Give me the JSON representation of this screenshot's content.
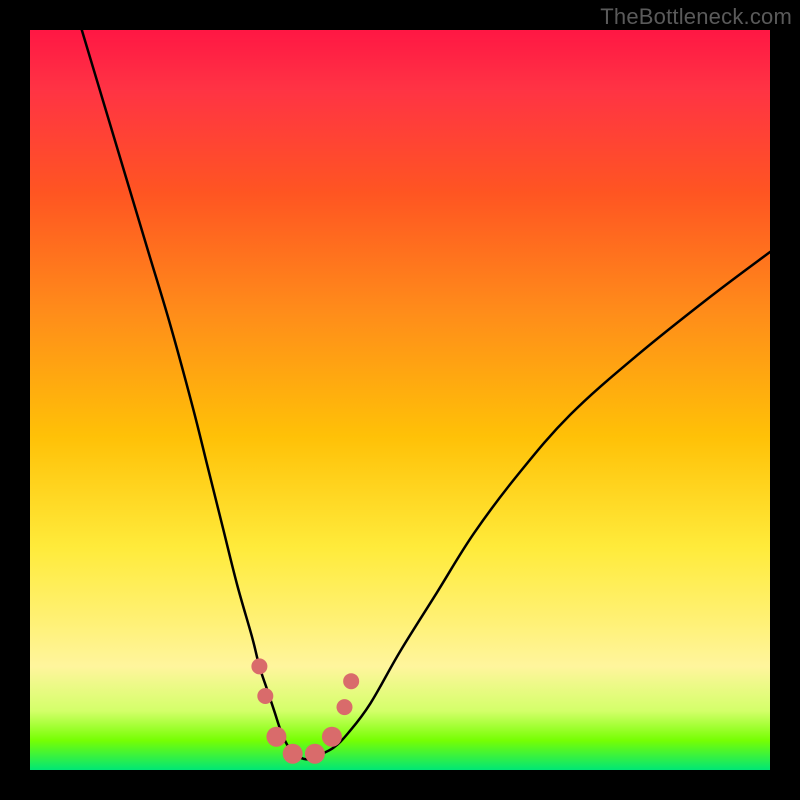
{
  "watermark": "TheBottleneck.com",
  "chart_data": {
    "type": "line",
    "title": "",
    "xlabel": "",
    "ylabel": "",
    "xlim": [
      0,
      100
    ],
    "ylim": [
      0,
      100
    ],
    "series": [
      {
        "name": "bottleneck-curve",
        "x": [
          7,
          10,
          13,
          16,
          19,
          22,
          24,
          26,
          28,
          30,
          31,
          32,
          33,
          34,
          35,
          36,
          37,
          38,
          39,
          41,
          43,
          46,
          50,
          55,
          60,
          66,
          73,
          82,
          92,
          100
        ],
        "y": [
          100,
          90,
          80,
          70,
          60,
          49,
          41,
          33,
          25,
          18,
          14,
          11,
          8,
          5,
          3,
          2,
          1.5,
          1.5,
          2,
          3,
          5,
          9,
          16,
          24,
          32,
          40,
          48,
          56,
          64,
          70
        ]
      }
    ],
    "markers": {
      "name": "highlighted-points",
      "color": "#d96b6b",
      "points": [
        {
          "x": 31.0,
          "y": 14,
          "r": 8
        },
        {
          "x": 31.8,
          "y": 10,
          "r": 8
        },
        {
          "x": 33.3,
          "y": 4.5,
          "r": 10
        },
        {
          "x": 35.5,
          "y": 2.2,
          "r": 10
        },
        {
          "x": 38.5,
          "y": 2.2,
          "r": 10
        },
        {
          "x": 40.8,
          "y": 4.5,
          "r": 10
        },
        {
          "x": 42.5,
          "y": 8.5,
          "r": 8
        },
        {
          "x": 43.4,
          "y": 12,
          "r": 8
        }
      ]
    }
  }
}
